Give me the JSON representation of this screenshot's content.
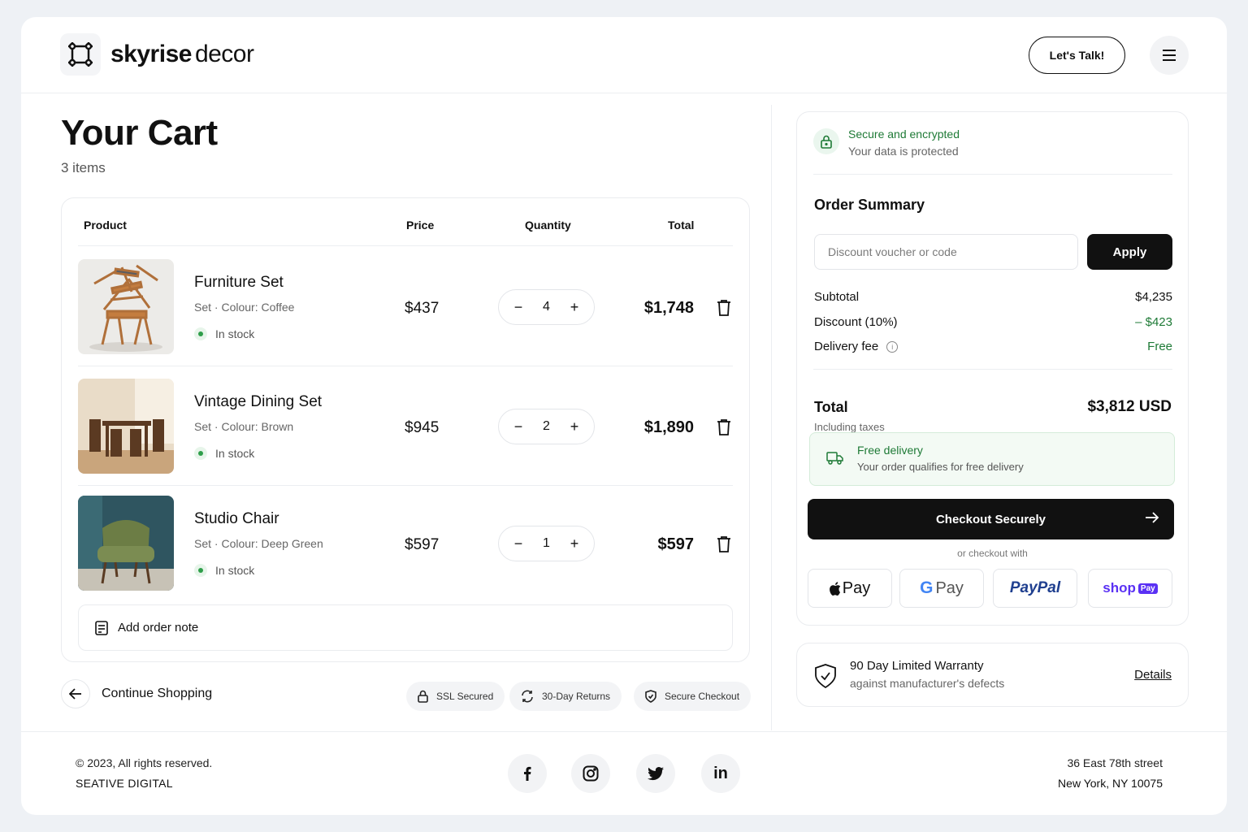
{
  "header": {
    "brand_bold": "skyrise",
    "brand_light": "decor",
    "cta_label": "Let's Talk!",
    "icons": {
      "logo": "frame-logo-icon",
      "menu": "hamburger-menu-icon"
    }
  },
  "cart": {
    "title": "Your Cart",
    "count_label": "3 items",
    "columns": {
      "product": "Product",
      "price": "Price",
      "quantity": "Quantity",
      "total": "Total"
    },
    "items": [
      {
        "name": "Furniture Set",
        "meta": "Set · Colour: Coffee",
        "stock": "In stock",
        "price": "$437",
        "qty": "4",
        "total": "$1,748",
        "image": "stacked-wooden-chairs-photo"
      },
      {
        "name": "Vintage Dining Set",
        "meta": "Set · Colour: Brown",
        "stock": "In stock",
        "price": "$945",
        "qty": "2",
        "total": "$1,890",
        "image": "wooden-dining-table-photo"
      },
      {
        "name": "Studio Chair",
        "meta": "Set · Colour: Deep Green",
        "stock": "In stock",
        "price": "$597",
        "qty": "1",
        "total": "$597",
        "image": "green-armchair-photo"
      }
    ],
    "note_label": "Add order note",
    "continue_label": "Continue Shopping",
    "badges": {
      "ssl": "SSL Secured",
      "returns": "30-Day Returns",
      "secure": "Secure Checkout"
    }
  },
  "summary": {
    "secure_title": "Secure and encrypted",
    "secure_sub": "Your data is protected",
    "title": "Order Summary",
    "voucher_placeholder": "Discount voucher or code",
    "apply_label": "Apply",
    "subtotal_label": "Subtotal",
    "subtotal_value": "$4,235",
    "discount_label": "Discount (10%)",
    "discount_value": "– $423",
    "delivery_label": "Delivery fee",
    "delivery_value": "Free",
    "total_label": "Total",
    "total_sub": "Including taxes",
    "total_value": "$3,812 USD",
    "free_title": "Free delivery",
    "free_sub": "Your order qualifies for free delivery",
    "checkout_label": "Checkout Securely",
    "or_label": "or checkout with",
    "pay": {
      "apple": "Pay",
      "google": "Pay",
      "paypal": "PayPal",
      "shop": "shop",
      "shop_badge": "Pay"
    }
  },
  "warranty": {
    "title": "90 Day Limited Warranty",
    "sub": "against manufacturer's defects",
    "link": "Details"
  },
  "footer": {
    "copyright": "© 2023, All rights reserved.",
    "company": "SEATIVE DIGITAL",
    "address1": "36 East 78th street",
    "address2": "New York, NY 10075",
    "social_icons": [
      "facebook-icon",
      "instagram-icon",
      "twitter-icon",
      "linkedin-icon"
    ]
  },
  "colors": {
    "accent": "#111111",
    "success": "#1e7a36",
    "success_bg": "#f3faf4",
    "page_bg": "#eef1f5"
  }
}
